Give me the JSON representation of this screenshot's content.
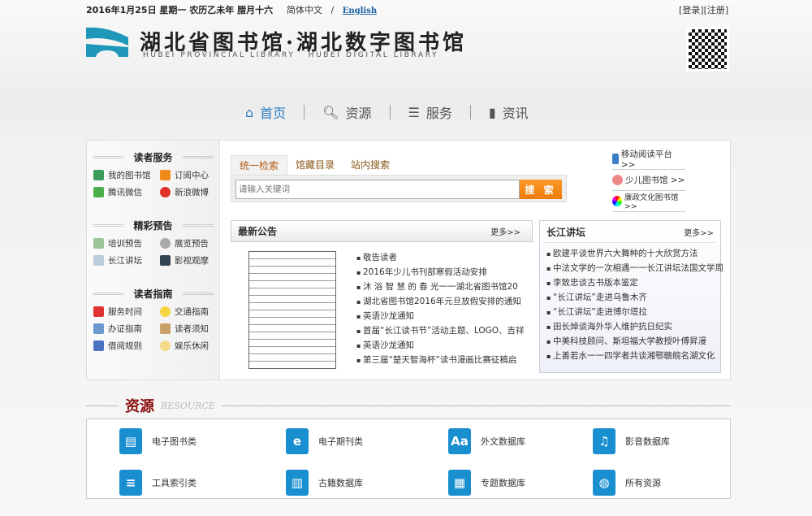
{
  "top": {
    "date": "2016年1月25日 星期一 农历乙未年 腊月十六",
    "lang_cn": "简体中文",
    "lang_sep": "/",
    "lang_en": "English",
    "login": "[登录]",
    "register": "[注册]"
  },
  "logo": {
    "cn": "湖北省图书馆·湖北数字图书馆",
    "en": "HUBEI PROVINCIAL LIBRARY   HUBEI DIGITAL LIBRARY"
  },
  "nav": [
    {
      "label": "首页",
      "icon": "home-icon"
    },
    {
      "label": "资源",
      "icon": "search-icon"
    },
    {
      "label": "服务",
      "icon": "list-icon"
    },
    {
      "label": "资讯",
      "icon": "book-icon"
    }
  ],
  "sidebar": [
    {
      "title": "读者服务",
      "items": [
        "我的图书馆",
        "订阅中心",
        "腾讯微信",
        "新浪微博"
      ]
    },
    {
      "title": "精彩预告",
      "items": [
        "培训预告",
        "展览预告",
        "长江讲坛",
        "影视观摩"
      ]
    },
    {
      "title": "读者指南",
      "items": [
        "服务时间",
        "交通指南",
        "办证指南",
        "读者须知",
        "借阅规则",
        "娱乐休闲"
      ]
    }
  ],
  "search": {
    "tabs": [
      "统一检索",
      "馆藏目录",
      "站内搜索"
    ],
    "placeholder": "请输入关键词",
    "button": "搜 索"
  },
  "links": [
    "移动阅读平台>>",
    "少儿图书馆 >>",
    "廉政文化图书馆>>"
  ],
  "notice": {
    "title": "最新公告",
    "more": "更多>>",
    "items": [
      "敬告读者",
      "2016年少儿书刊部寒假活动安排",
      "沐 浴 智 慧 的 春 光一一湖北省图书馆20",
      "湖北省图书馆2016年元旦放假安排的通知",
      "英语沙龙通知",
      "首届“长江读书节”活动主题、LOGO、吉祥",
      "英语沙龙通知",
      "第三届“楚天智海杯”读书漫画比赛征稿启"
    ]
  },
  "forum": {
    "title": "长江讲坛",
    "more": "更多>>",
    "items": [
      "欧建平谈世界六大舞种的十大欣赏方法",
      "中法文学的一次相遇一一长江讲坛法国文学周",
      "李致忠谈古书版本鉴定",
      "“长江讲坛”走进乌鲁木齐",
      "“长江讲坛”走进博尔塔拉",
      "田长焯谈海外华人维护抗日纪实",
      "中美科技顾问、斯坦福大学教授叶傅昇漫",
      "上善若水一一四学者共谈湘鄂赣皖名湖文化"
    ]
  },
  "resource": {
    "title": "资源",
    "subtitle": "RESOURCE",
    "items": [
      {
        "label": "电子图书类",
        "glyph": "▤"
      },
      {
        "label": "电子期刊类",
        "glyph": "e"
      },
      {
        "label": "外文数据库",
        "glyph": "Aa"
      },
      {
        "label": "影音数据库",
        "glyph": "♫"
      },
      {
        "label": "工具索引类",
        "glyph": "≡"
      },
      {
        "label": "古籍数据库",
        "glyph": "▥"
      },
      {
        "label": "专题数据库",
        "glyph": "▦"
      },
      {
        "label": "所有资源",
        "glyph": "◍"
      }
    ]
  },
  "colors": {
    "accent": "#2b7bc0",
    "button": "#ee7b0a",
    "resource_title": "#8b1010"
  }
}
